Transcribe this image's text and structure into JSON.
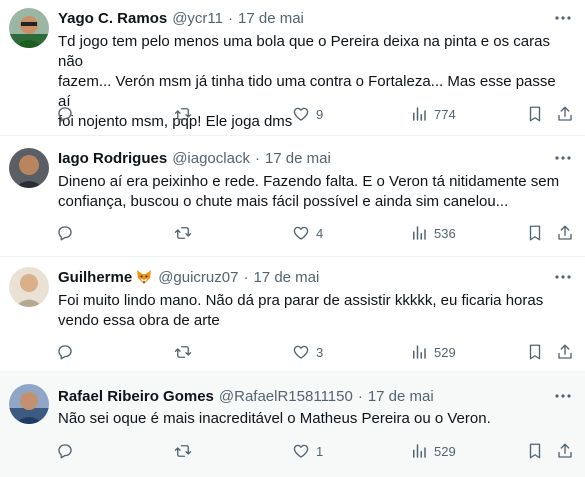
{
  "tweets": [
    {
      "name": "Yago C. Ramos",
      "handle": "@ycr11",
      "dot": "·",
      "time": "17 de mai",
      "text": "Td jogo tem pelo menos uma bola que o Pereira deixa na pinta e os caras não\nfazem... Verón msm já tinha tido uma contra o Fortaleza... Mas esse passe aí\nfoi nojento msm, pqp! Ele joga dms",
      "replies": "",
      "retweets": "",
      "likes": "9",
      "views": "774"
    },
    {
      "name": "Iago Rodrigues",
      "handle": "@iagoclack",
      "dot": "·",
      "time": "17 de mai",
      "text": "Dineno aí era peixinho e rede. Fazendo falta. E o Veron tá nitidamente sem\nconfiança, buscou o chute mais fácil possível e ainda sim canelou...",
      "replies": "",
      "retweets": "",
      "likes": "4",
      "views": "536"
    },
    {
      "name": "Guilherme",
      "name_emoji": "fox-face-icon",
      "handle": "@guicruz07",
      "dot": "·",
      "time": "17 de mai",
      "text": "Foi muito lindo mano. Não dá pra parar de assistir kkkkk, eu ficaria horas\nvendo essa obra de arte",
      "replies": "",
      "retweets": "",
      "likes": "3",
      "views": "529"
    },
    {
      "name": "Rafael Ribeiro Gomes",
      "handle": "@RafaelR15811150",
      "dot": "·",
      "time": "17 de mai",
      "text": "Não sei oque é mais inacreditável o Matheus Pereira ou o Veron.",
      "replies": "",
      "retweets": "",
      "likes": "1",
      "views": "529"
    }
  ],
  "colors": {
    "text": "#0f1419",
    "muted": "#536471",
    "divider": "#eff3f4",
    "highlight_bg": "#f7f9f9"
  },
  "icons": [
    "more-icon",
    "reply-icon",
    "retweet-icon",
    "like-icon",
    "views-icon",
    "bookmark-icon",
    "share-icon"
  ]
}
